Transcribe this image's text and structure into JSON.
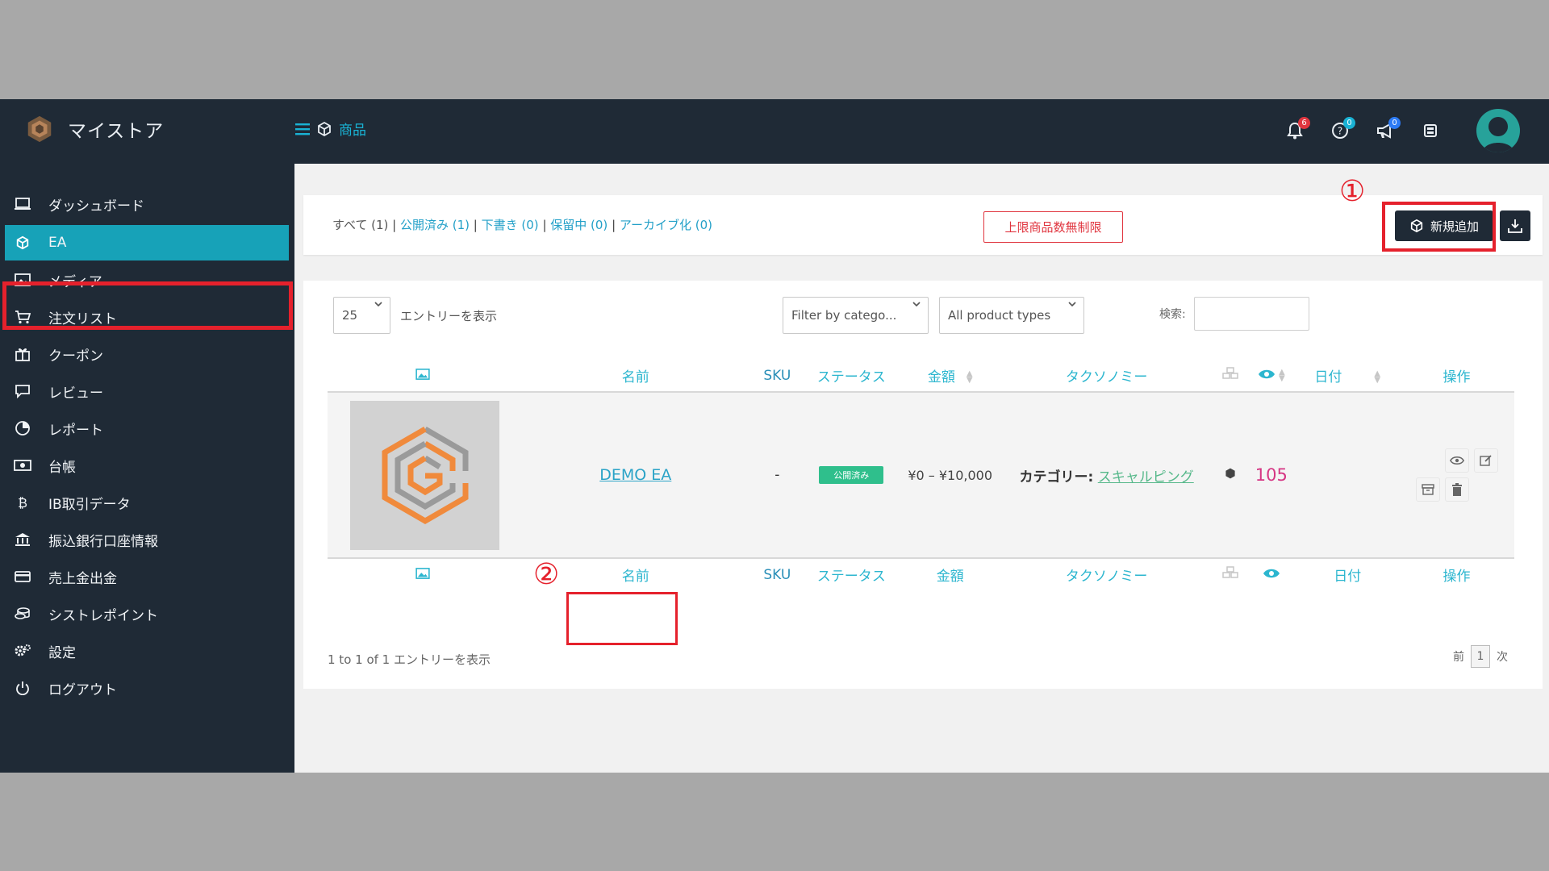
{
  "app": {
    "name": "マイストア"
  },
  "breadcrumb": {
    "label": "商品"
  },
  "notifications": {
    "bell_count": "6",
    "help_count": "0",
    "announce_count": "0"
  },
  "sidebar": {
    "items": [
      {
        "label": "ダッシュボード",
        "icon": "monitor-icon"
      },
      {
        "label": "EA",
        "icon": "box-icon",
        "active": true
      },
      {
        "label": "メディア",
        "icon": "image-icon"
      },
      {
        "label": "注文リスト",
        "icon": "cart-icon"
      },
      {
        "label": "クーポン",
        "icon": "gift-icon"
      },
      {
        "label": "レビュー",
        "icon": "comment-icon"
      },
      {
        "label": "レポート",
        "icon": "pie-chart-icon"
      },
      {
        "label": "台帳",
        "icon": "cash-icon"
      },
      {
        "label": "IB取引データ",
        "icon": "bitcoin-icon"
      },
      {
        "label": "振込銀行口座情報",
        "icon": "bank-icon"
      },
      {
        "label": "売上金出金",
        "icon": "credit-card-icon"
      },
      {
        "label": "シストレポイント",
        "icon": "coins-icon"
      },
      {
        "label": "設定",
        "icon": "gears-icon"
      },
      {
        "label": "ログアウト",
        "icon": "power-icon"
      }
    ]
  },
  "status_filter": {
    "all": "すべて (1)",
    "published": "公開済み (1)",
    "draft": "下書き (0)",
    "pending": "保留中 (0)",
    "archived": "アーカイブ化 (0)"
  },
  "limit_button": "上限商品数無制限",
  "add_button": "新規追加",
  "annotations": {
    "one": "①",
    "two": "②"
  },
  "table_controls": {
    "length_value": "25",
    "length_label": "エントリーを表示",
    "category_filter": "Filter by catego...",
    "type_filter": "All product types",
    "search_label": "検索:"
  },
  "columns": {
    "name": "名前",
    "sku": "SKU",
    "status": "ステータス",
    "price": "金額",
    "taxonomy": "タクソノミー",
    "date": "日付",
    "actions": "操作"
  },
  "product": {
    "name": "DEMO EA",
    "sku": "-",
    "status": "公開済み",
    "price": "¥0 – ¥10,000",
    "taxonomy_label": "カテゴリー:",
    "taxonomy_value": "スキャルピング",
    "views": "105"
  },
  "footer": {
    "info": "1 to 1 of 1 エントリーを表示",
    "prev": "前",
    "page": "1",
    "next": "次"
  },
  "colors": {
    "topbar": "#1f2a36",
    "accent": "#17a2b8",
    "highlight": "#e5212c",
    "status_green": "#2fbf8c",
    "views_pink": "#d63684"
  }
}
